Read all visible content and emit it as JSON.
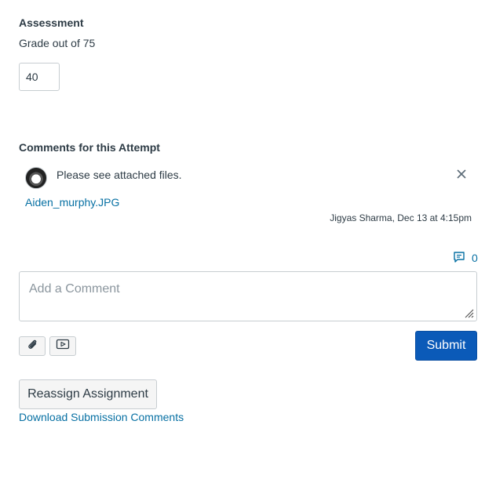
{
  "assessment": {
    "heading": "Assessment",
    "grade_label": "Grade out of 75",
    "grade_value": "40"
  },
  "comments": {
    "heading": "Comments for this Attempt",
    "items": [
      {
        "text": "Please see attached files.",
        "attachment": "Aiden_murphy.JPG",
        "meta": "Jigyas Sharma, Dec 13 at 4:15pm"
      }
    ],
    "count": "0",
    "count_icon": "comment-icon",
    "close_icon": "close-icon"
  },
  "comment_input": {
    "placeholder": "Add a Comment",
    "attach_icon": "paperclip-icon",
    "media_icon": "media-icon",
    "submit_label": "Submit"
  },
  "actions": {
    "reassign_label": "Reassign Assignment",
    "download_label": "Download Submission Comments"
  },
  "colors": {
    "text": "#2d3b45",
    "link": "#0770a3",
    "primary": "#0b5ab8",
    "border": "#c7cdd1"
  }
}
